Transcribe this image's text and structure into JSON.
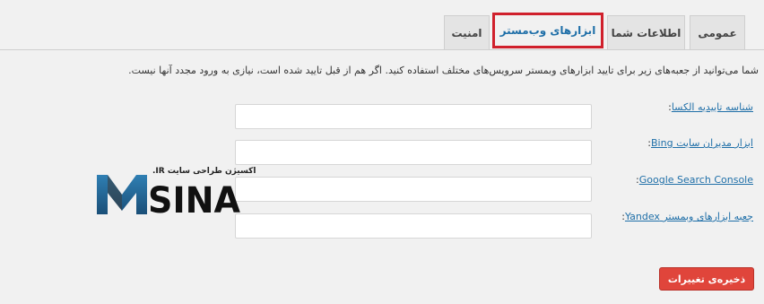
{
  "tabs": [
    {
      "label": "عمومی",
      "active": false
    },
    {
      "label": "اطلاعات شما",
      "active": false
    },
    {
      "label": "ابزارهای وب‌مستر",
      "active": true
    },
    {
      "label": "امنیت",
      "active": false
    }
  ],
  "description": "شما می‌توانید از جعبه‌های زیر برای تایید ابزارهای وبمستر سرویس‌های مختلف استفاده کنید. اگر هم از قبل تایید شده است، نیازی به ورود مجدد آنها نیست.",
  "fields": [
    {
      "label": "شناسه تاییدیه الکسا",
      "suffix": ":",
      "value": ""
    },
    {
      "label": "ابزار مدیران سایت Bing",
      "suffix": ":",
      "value": ""
    },
    {
      "label": "Google Search Console",
      "suffix": ":",
      "value": ""
    },
    {
      "label": "جعبه ابزارهای وبمستر Yandex",
      "suffix": ":",
      "value": ""
    }
  ],
  "save_button": "ذخیره‌ی تغییرات",
  "watermark": {
    "logo_text": "SINA",
    "logo_letter": "M",
    "caption": ".IR اکسیژن طراحی سایت"
  },
  "colors": {
    "accent": "#1f6fa8",
    "highlight": "#d0202c",
    "save": "#e0453b"
  }
}
